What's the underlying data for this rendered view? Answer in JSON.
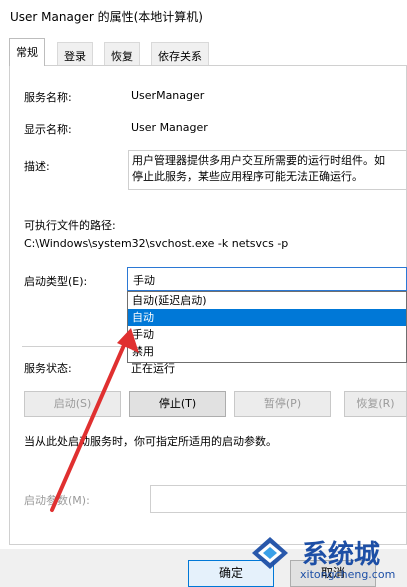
{
  "window": {
    "title": "User Manager 的属性(本地计算机)"
  },
  "tabs": [
    {
      "label": "常规"
    },
    {
      "label": "登录"
    },
    {
      "label": "恢复"
    },
    {
      "label": "依存关系"
    }
  ],
  "general": {
    "service_name_label": "服务名称:",
    "service_name_value": "UserManager",
    "display_name_label": "显示名称:",
    "display_name_value": "User Manager",
    "description_label": "描述:",
    "description_line1": "用户管理器提供多用户交互所需要的运行时组件。如",
    "description_line2": "停止此服务，某些应用程序可能无法正确运行。",
    "exe_path_label": "可执行文件的路径:",
    "exe_path_value": "C:\\Windows\\system32\\svchost.exe -k netsvcs -p",
    "startup_type_label": "启动类型(E):",
    "startup_type_selected": "手动",
    "startup_options": [
      "自动(延迟启动)",
      "自动",
      "手动",
      "禁用"
    ],
    "service_status_label": "服务状态:",
    "service_status_value": "正在运行",
    "buttons": {
      "start": "启动(S)",
      "stop": "停止(T)",
      "pause": "暂停(P)",
      "resume": "恢复(R)"
    },
    "hint_text": "当从此处启动服务时，你可指定所适用的启动参数。",
    "start_params_label": "启动参数(M):",
    "start_params_value": ""
  },
  "dialog_buttons": {
    "ok": "确定",
    "cancel": "取消"
  },
  "watermark": {
    "brand": "系统城",
    "url": "xitongcheng.com"
  },
  "colors": {
    "accent": "#0078d7",
    "arrow": "#e03030",
    "watermark": "#1d4fa6"
  }
}
